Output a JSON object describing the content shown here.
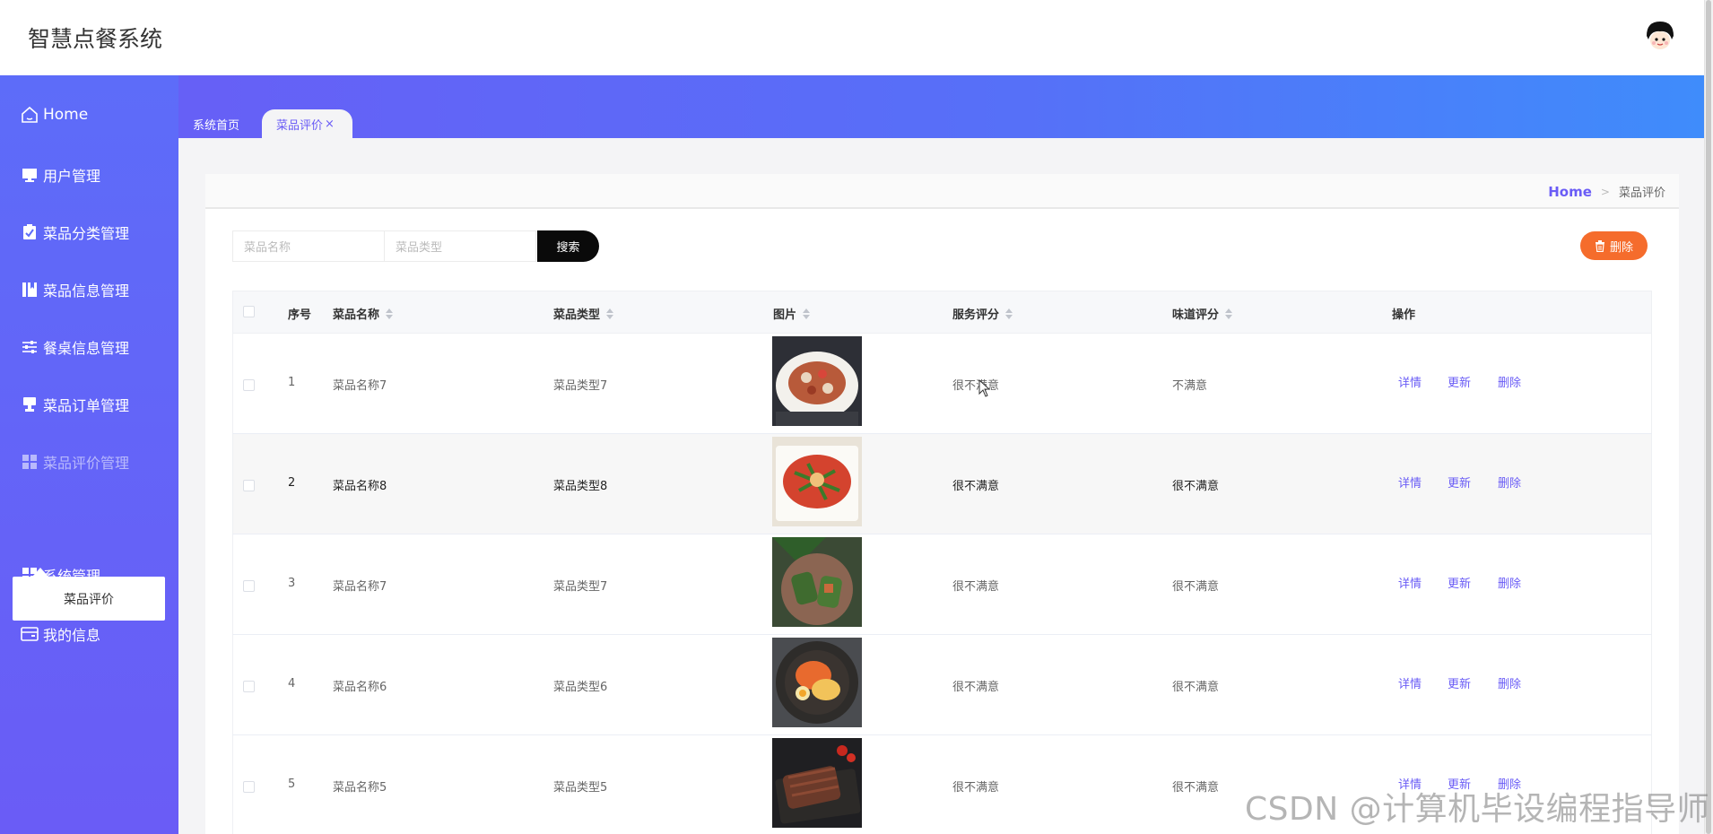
{
  "app": {
    "title": "智慧点餐系统"
  },
  "sidebar": {
    "items": [
      {
        "label": "Home",
        "icon": "home-icon"
      },
      {
        "label": "用户管理",
        "icon": "monitor-icon"
      },
      {
        "label": "菜品分类管理",
        "icon": "clipboard-check-icon"
      },
      {
        "label": "菜品信息管理",
        "icon": "book-icon"
      },
      {
        "label": "餐桌信息管理",
        "icon": "sliders-icon"
      },
      {
        "label": "菜品订单管理",
        "icon": "stamp-icon"
      },
      {
        "label": "菜品评价管理",
        "icon": "grid-icon"
      },
      {
        "label": "系统管理",
        "icon": "grid-icon"
      },
      {
        "label": "我的信息",
        "icon": "wallet-icon"
      }
    ],
    "submenu": {
      "label": "菜品评价"
    }
  },
  "tabs": [
    {
      "label": "系统首页"
    },
    {
      "label": "菜品评价",
      "close": "×"
    }
  ],
  "breadcrumb": {
    "home": "Home",
    "separator": ">",
    "current": "菜品评价"
  },
  "search": {
    "name_placeholder": "菜品名称",
    "type_placeholder": "菜品类型",
    "button": "搜索"
  },
  "toolbar": {
    "delete_label": "删除"
  },
  "table": {
    "columns": [
      "序号",
      "菜品名称",
      "菜品类型",
      "图片",
      "服务评分",
      "味道评分",
      "操作"
    ],
    "actions": [
      "详情",
      "更新",
      "删除"
    ],
    "rows": [
      {
        "index": "1",
        "name": "菜品名称7",
        "type": "菜品类型7",
        "service": "很不满意",
        "taste": "不满意"
      },
      {
        "index": "2",
        "name": "菜品名称8",
        "type": "菜品类型8",
        "service": "很不满意",
        "taste": "很不满意"
      },
      {
        "index": "3",
        "name": "菜品名称7",
        "type": "菜品类型7",
        "service": "很不满意",
        "taste": "很不满意"
      },
      {
        "index": "4",
        "name": "菜品名称6",
        "type": "菜品类型6",
        "service": "很不满意",
        "taste": "很不满意"
      },
      {
        "index": "5",
        "name": "菜品名称5",
        "type": "菜品类型5",
        "service": "很不满意",
        "taste": "很不满意"
      }
    ]
  },
  "watermark": "CSDN @计算机毕设编程指导师",
  "colors": {
    "accent": "#6a5cf6",
    "danger": "#f56c2c",
    "header_gradient_end": "#3f8cfb"
  }
}
